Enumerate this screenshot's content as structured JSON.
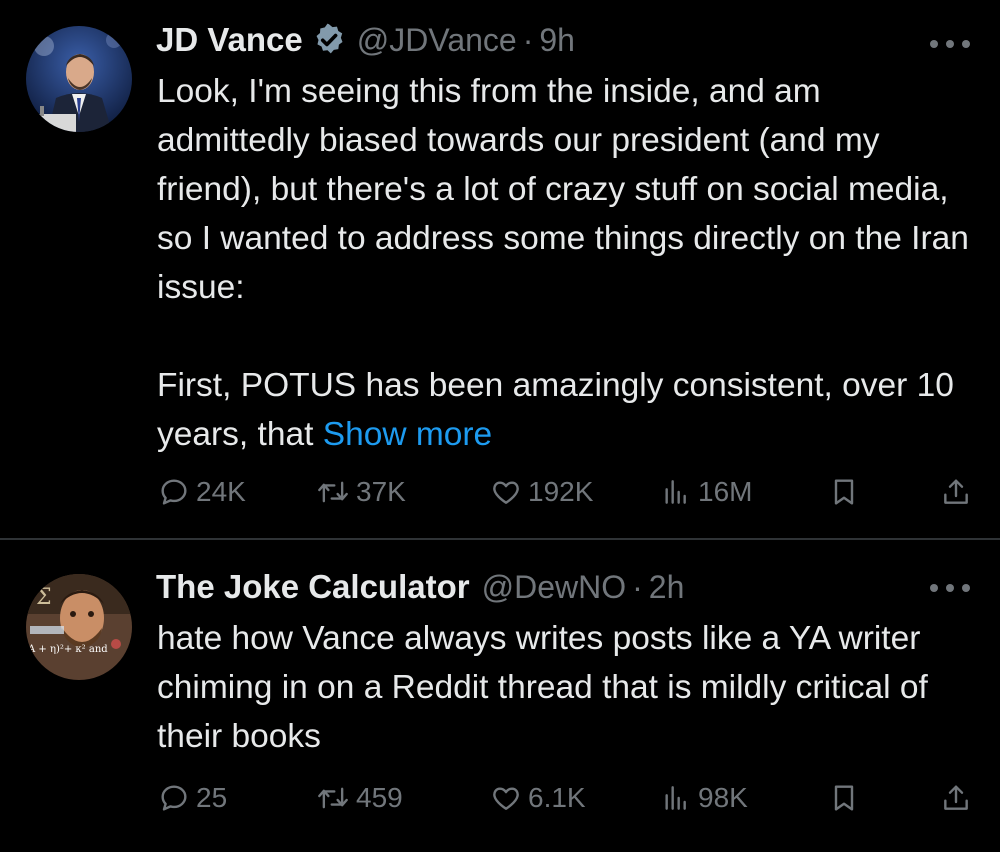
{
  "colors": {
    "background": "#000000",
    "text_primary": "#e7e9ea",
    "text_secondary": "#71767b",
    "link": "#1d9bf0",
    "verified": "#829aab",
    "divider": "#2f3336"
  },
  "tweets": [
    {
      "author": "JD Vance",
      "verified": true,
      "handle": "@JDVance",
      "separator": "·",
      "time": "9h",
      "text": "Look, I'm seeing this from the inside, and am admittedly biased towards our president (and my friend), but there's a lot of crazy stuff on social media, so I wanted to address some things directly on the Iran issue:\n\nFirst, POTUS has been amazingly consistent, over 10 years, that ",
      "show_more": "Show more",
      "replies": "24K",
      "retweets": "37K",
      "likes": "192K",
      "views": "16M",
      "icons": [
        "reply-icon",
        "retweet-icon",
        "like-icon",
        "views-icon",
        "bookmark-icon",
        "share-icon",
        "more-icon"
      ]
    },
    {
      "author": "The Joke Calculator",
      "verified": false,
      "handle": "@DewNO",
      "separator": "·",
      "time": "2h",
      "text": "hate how Vance always writes posts like a YA writer chiming in on a Reddit thread that is mildly critical of their books",
      "replies": "25",
      "retweets": "459",
      "likes": "6.1K",
      "views": "98K",
      "icons": [
        "reply-icon",
        "retweet-icon",
        "like-icon",
        "views-icon",
        "bookmark-icon",
        "share-icon",
        "more-icon"
      ]
    }
  ]
}
